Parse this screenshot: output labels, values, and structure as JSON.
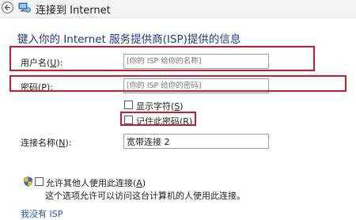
{
  "window": {
    "title": "连接到 Internet"
  },
  "heading": "键入你的 Internet 服务提供商(ISP)提供的信息",
  "form": {
    "username": {
      "label_pre": "用户名(",
      "label_key": "U",
      "label_post": "):",
      "placeholder": "[你的 ISP 给你的名称]"
    },
    "password": {
      "label_pre": "密码(",
      "label_key": "P",
      "label_post": "):",
      "placeholder": "[你的 ISP 给你的密码]"
    },
    "show_chars": {
      "label_pre": "显示字符(",
      "label_key": "S",
      "label_post": ")",
      "checked": false
    },
    "remember": {
      "label_pre": "记住此密码(",
      "label_key": "R",
      "label_post": ")",
      "checked": false
    },
    "connection_name": {
      "label_pre": "连接名称(",
      "label_key": "N",
      "label_post": "):",
      "value": "宽带连接 2"
    },
    "allow_others": {
      "label_pre": "允许其他人使用此连接(",
      "label_key": "A",
      "label_post": ")",
      "checked": false,
      "description": "这个选项允许可以访问这台计算机的人使用此连接。"
    }
  },
  "no_isp_link": "我没有 ISP",
  "colors": {
    "heading": "#1a3e7c",
    "highlight": "#cc1a2e",
    "link": "#1c5cb5"
  }
}
